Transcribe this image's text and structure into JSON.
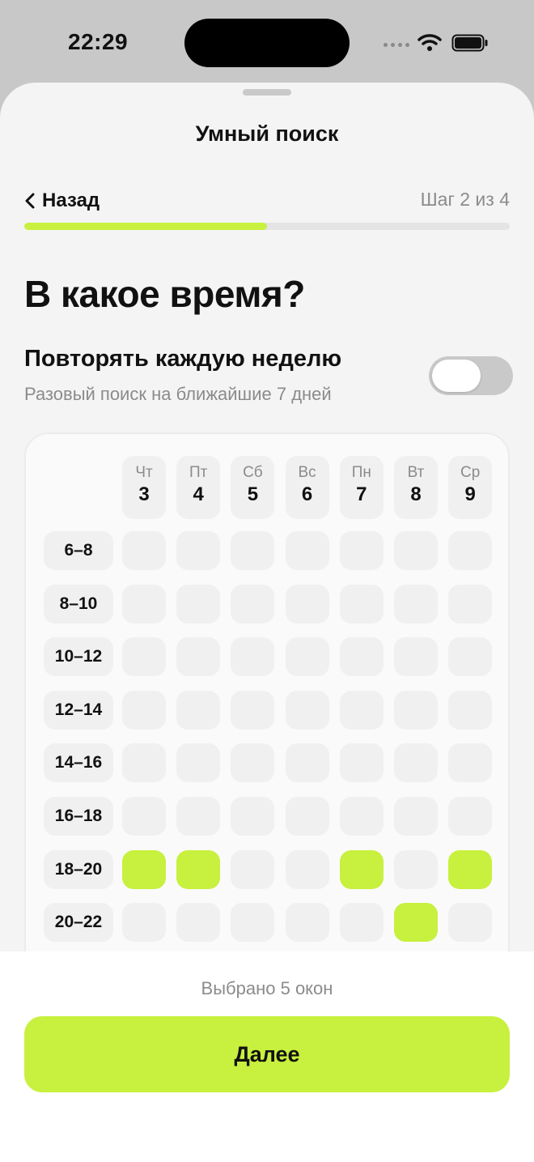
{
  "status_bar": {
    "time": "22:29",
    "icons": [
      "cellular-icon",
      "wifi-icon",
      "battery-icon"
    ]
  },
  "sheet": {
    "title": "Умный поиск",
    "back_label": "Назад",
    "step_label": "Шаг 2 из 4",
    "progress": {
      "current_step": 2,
      "total_steps": 4,
      "fraction": 0.5
    }
  },
  "main": {
    "heading": "В какое время?",
    "repeat_title": "Повторять каждую неделю",
    "repeat_subtitle": "Разовый поиск на ближайшие 7 дней",
    "repeat_enabled": false
  },
  "grid": {
    "days": [
      {
        "name": "Чт",
        "num": "3"
      },
      {
        "name": "Пт",
        "num": "4"
      },
      {
        "name": "Сб",
        "num": "5"
      },
      {
        "name": "Вс",
        "num": "6"
      },
      {
        "name": "Пн",
        "num": "7"
      },
      {
        "name": "Вт",
        "num": "8"
      },
      {
        "name": "Ср",
        "num": "9"
      }
    ],
    "time_slots": [
      "6–8",
      "8–10",
      "10–12",
      "12–14",
      "14–16",
      "16–18",
      "18–20",
      "20–22"
    ],
    "selected": [
      {
        "slot": "18–20",
        "day": "3"
      },
      {
        "slot": "18–20",
        "day": "4"
      },
      {
        "slot": "18–20",
        "day": "7"
      },
      {
        "slot": "18–20",
        "day": "9"
      },
      {
        "slot": "20–22",
        "day": "8"
      }
    ]
  },
  "footer": {
    "selected_count_text": "Выбрано 5 окон",
    "next_label": "Далее"
  },
  "colors": {
    "accent": "#c8f03e",
    "background": "#f4f4f4",
    "cell": "#f0f0f0",
    "muted_text": "#8b8b8b"
  }
}
